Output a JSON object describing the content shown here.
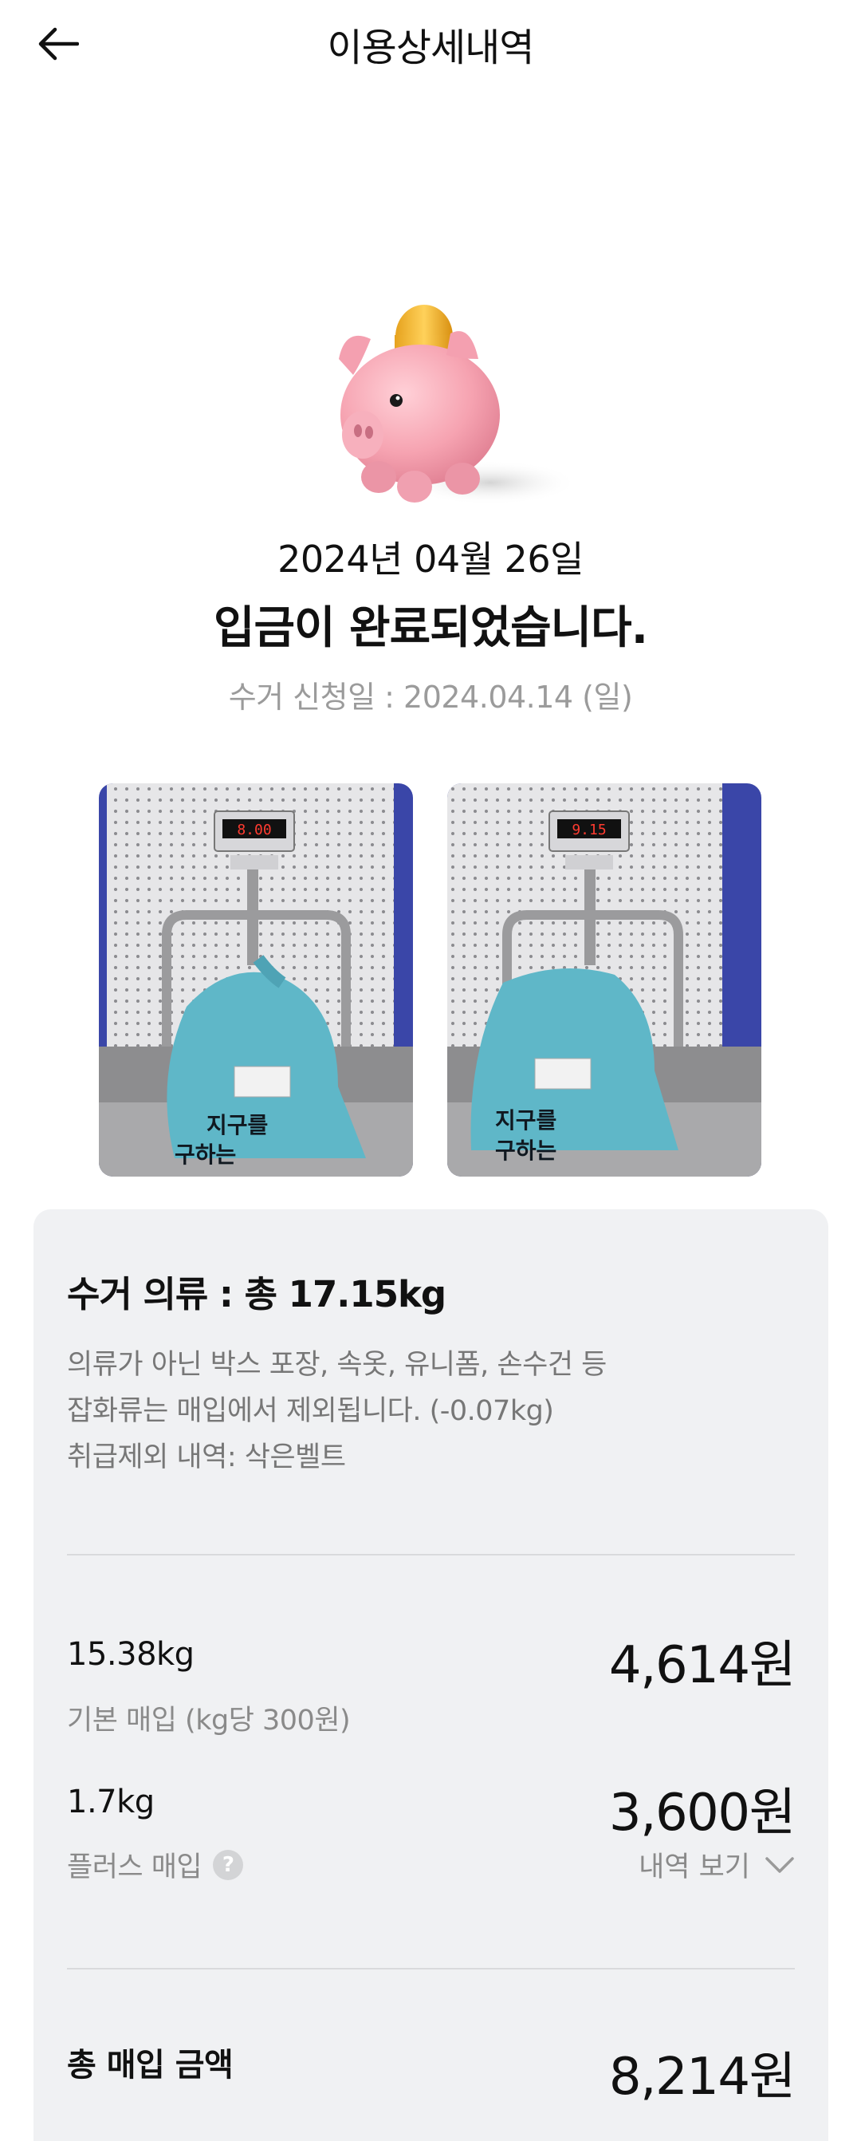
{
  "header": {
    "title": "이용상세내역"
  },
  "status": {
    "deposit_date": "2024년 04월 26일",
    "message": "입금이 완료되었습니다.",
    "request_date": "수거 신청일 : 2024.04.14 (일)"
  },
  "photos": [
    {
      "scale_reading": "8.00",
      "bag_text": "지구를 구하는"
    },
    {
      "scale_reading": "9.15",
      "bag_text": "지구를 구하는"
    }
  ],
  "summary": {
    "title": "수거 의류 : 총 17.15kg",
    "notes": [
      "의류가 아닌 박스 포장, 속옷, 유니폼, 손수건 등",
      "잡화류는 매입에서 제외됩니다. (-0.07kg)",
      "취급제외 내역: 삭은벨트"
    ],
    "basic": {
      "weight": "15.38kg",
      "label": "기본 매입 (kg당 300원)",
      "amount": "4,614원"
    },
    "plus": {
      "weight": "1.7kg",
      "label": "플러스 매입",
      "help_icon": "?",
      "amount": "3,600원",
      "detail_link": "내역 보기"
    },
    "total": {
      "label": "총 매입 금액",
      "amount": "8,214원"
    }
  }
}
